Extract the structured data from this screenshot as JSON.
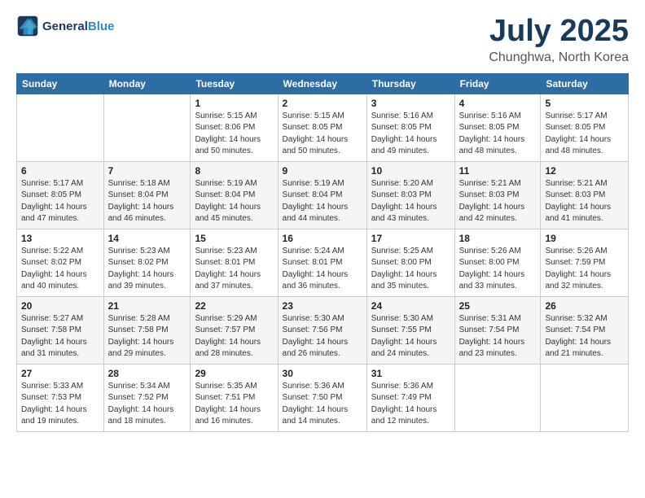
{
  "logo": {
    "line1": "General",
    "line2": "Blue"
  },
  "title": "July 2025",
  "subtitle": "Chunghwa, North Korea",
  "weekdays": [
    "Sunday",
    "Monday",
    "Tuesday",
    "Wednesday",
    "Thursday",
    "Friday",
    "Saturday"
  ],
  "weeks": [
    [
      {
        "day": "",
        "info": ""
      },
      {
        "day": "",
        "info": ""
      },
      {
        "day": "1",
        "info": "Sunrise: 5:15 AM\nSunset: 8:06 PM\nDaylight: 14 hours\nand 50 minutes."
      },
      {
        "day": "2",
        "info": "Sunrise: 5:15 AM\nSunset: 8:05 PM\nDaylight: 14 hours\nand 50 minutes."
      },
      {
        "day": "3",
        "info": "Sunrise: 5:16 AM\nSunset: 8:05 PM\nDaylight: 14 hours\nand 49 minutes."
      },
      {
        "day": "4",
        "info": "Sunrise: 5:16 AM\nSunset: 8:05 PM\nDaylight: 14 hours\nand 48 minutes."
      },
      {
        "day": "5",
        "info": "Sunrise: 5:17 AM\nSunset: 8:05 PM\nDaylight: 14 hours\nand 48 minutes."
      }
    ],
    [
      {
        "day": "6",
        "info": "Sunrise: 5:17 AM\nSunset: 8:05 PM\nDaylight: 14 hours\nand 47 minutes."
      },
      {
        "day": "7",
        "info": "Sunrise: 5:18 AM\nSunset: 8:04 PM\nDaylight: 14 hours\nand 46 minutes."
      },
      {
        "day": "8",
        "info": "Sunrise: 5:19 AM\nSunset: 8:04 PM\nDaylight: 14 hours\nand 45 minutes."
      },
      {
        "day": "9",
        "info": "Sunrise: 5:19 AM\nSunset: 8:04 PM\nDaylight: 14 hours\nand 44 minutes."
      },
      {
        "day": "10",
        "info": "Sunrise: 5:20 AM\nSunset: 8:03 PM\nDaylight: 14 hours\nand 43 minutes."
      },
      {
        "day": "11",
        "info": "Sunrise: 5:21 AM\nSunset: 8:03 PM\nDaylight: 14 hours\nand 42 minutes."
      },
      {
        "day": "12",
        "info": "Sunrise: 5:21 AM\nSunset: 8:03 PM\nDaylight: 14 hours\nand 41 minutes."
      }
    ],
    [
      {
        "day": "13",
        "info": "Sunrise: 5:22 AM\nSunset: 8:02 PM\nDaylight: 14 hours\nand 40 minutes."
      },
      {
        "day": "14",
        "info": "Sunrise: 5:23 AM\nSunset: 8:02 PM\nDaylight: 14 hours\nand 39 minutes."
      },
      {
        "day": "15",
        "info": "Sunrise: 5:23 AM\nSunset: 8:01 PM\nDaylight: 14 hours\nand 37 minutes."
      },
      {
        "day": "16",
        "info": "Sunrise: 5:24 AM\nSunset: 8:01 PM\nDaylight: 14 hours\nand 36 minutes."
      },
      {
        "day": "17",
        "info": "Sunrise: 5:25 AM\nSunset: 8:00 PM\nDaylight: 14 hours\nand 35 minutes."
      },
      {
        "day": "18",
        "info": "Sunrise: 5:26 AM\nSunset: 8:00 PM\nDaylight: 14 hours\nand 33 minutes."
      },
      {
        "day": "19",
        "info": "Sunrise: 5:26 AM\nSunset: 7:59 PM\nDaylight: 14 hours\nand 32 minutes."
      }
    ],
    [
      {
        "day": "20",
        "info": "Sunrise: 5:27 AM\nSunset: 7:58 PM\nDaylight: 14 hours\nand 31 minutes."
      },
      {
        "day": "21",
        "info": "Sunrise: 5:28 AM\nSunset: 7:58 PM\nDaylight: 14 hours\nand 29 minutes."
      },
      {
        "day": "22",
        "info": "Sunrise: 5:29 AM\nSunset: 7:57 PM\nDaylight: 14 hours\nand 28 minutes."
      },
      {
        "day": "23",
        "info": "Sunrise: 5:30 AM\nSunset: 7:56 PM\nDaylight: 14 hours\nand 26 minutes."
      },
      {
        "day": "24",
        "info": "Sunrise: 5:30 AM\nSunset: 7:55 PM\nDaylight: 14 hours\nand 24 minutes."
      },
      {
        "day": "25",
        "info": "Sunrise: 5:31 AM\nSunset: 7:54 PM\nDaylight: 14 hours\nand 23 minutes."
      },
      {
        "day": "26",
        "info": "Sunrise: 5:32 AM\nSunset: 7:54 PM\nDaylight: 14 hours\nand 21 minutes."
      }
    ],
    [
      {
        "day": "27",
        "info": "Sunrise: 5:33 AM\nSunset: 7:53 PM\nDaylight: 14 hours\nand 19 minutes."
      },
      {
        "day": "28",
        "info": "Sunrise: 5:34 AM\nSunset: 7:52 PM\nDaylight: 14 hours\nand 18 minutes."
      },
      {
        "day": "29",
        "info": "Sunrise: 5:35 AM\nSunset: 7:51 PM\nDaylight: 14 hours\nand 16 minutes."
      },
      {
        "day": "30",
        "info": "Sunrise: 5:36 AM\nSunset: 7:50 PM\nDaylight: 14 hours\nand 14 minutes."
      },
      {
        "day": "31",
        "info": "Sunrise: 5:36 AM\nSunset: 7:49 PM\nDaylight: 14 hours\nand 12 minutes."
      },
      {
        "day": "",
        "info": ""
      },
      {
        "day": "",
        "info": ""
      }
    ]
  ]
}
